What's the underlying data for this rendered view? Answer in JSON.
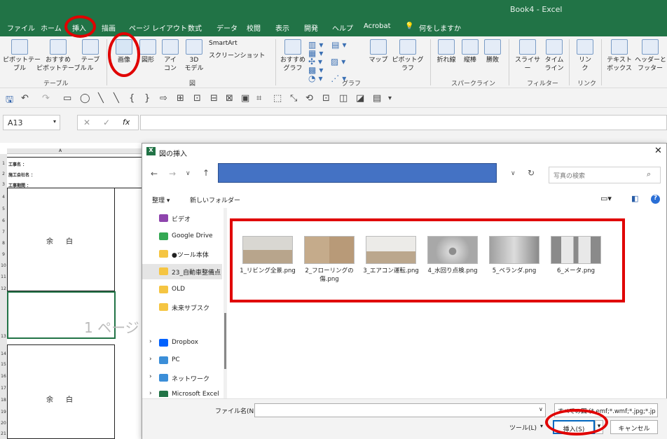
{
  "app": {
    "title": "Book4 - Excel"
  },
  "tabs": [
    "ファイル",
    "ホーム",
    "挿入",
    "描画",
    "ページ レイアウト",
    "数式",
    "データ",
    "校閲",
    "表示",
    "開発",
    "ヘルプ",
    "Acrobat",
    "何をしますか"
  ],
  "ribbon": {
    "pivot": "ピボットテー\nブル",
    "recommended_pivot": "おすすめ\nピボットテーブル",
    "table": "テーブル",
    "table_group": "テーブル",
    "image": "画像",
    "shape": "図形",
    "icon": "アイ\nコン",
    "model3d": "3D\nモデル",
    "smartart": "SmartArt",
    "screenshot": "スクリーンショット",
    "fig_group": "図",
    "rec_chart": "おすすめ\nグラフ",
    "map": "マップ",
    "pivot_chart": "ピボットグラフ",
    "chart_group": "グラフ",
    "line": "折れ線",
    "column": "縦棒",
    "winloss": "勝敗",
    "spark_group": "スパークライン",
    "slicer": "スライサー",
    "timeline": "タイム\nライン",
    "filter_group": "フィルター",
    "link": "リン\nク",
    "link_group": "リンク",
    "textbox": "テキスト\nボックス",
    "header": "ヘッダーと\nフッター"
  },
  "namebox": "A13",
  "fx": "fx",
  "sheet": {
    "col_a": "A",
    "row_labels": [
      "1",
      "2",
      "3",
      "4",
      "5",
      "6",
      "7",
      "8",
      "9",
      "10",
      "11",
      "12",
      "13",
      "14",
      "15",
      "16",
      "17",
      "18",
      "19",
      "20",
      "21",
      "22"
    ],
    "h1": "工事名 ：",
    "h2": "施工会社名 ：",
    "h3": "工事期間 ：",
    "margin1": "余白",
    "page_watermark": "1 ページ",
    "margin2": "余白"
  },
  "dialog": {
    "title": "図の挿入",
    "search_placeholder": "写真の検索",
    "organize": "整理 ▾",
    "new_folder": "新しいフォルダー",
    "nav": [
      "ビデオ",
      "Google Drive",
      "●ツール本体",
      "23_自動車整備点",
      "OLD",
      "未来サブスク",
      "Dropbox",
      "PC",
      "ネットワーク",
      "Microsoft Excel"
    ],
    "files": [
      "1_リビング全景.png",
      "2_フローリングの傷.png",
      "3_エアコン運転.png",
      "4_水回り点検.png",
      "5_ベランダ.png",
      "6_メータ.png"
    ],
    "filename_label": "ファイル名(N):",
    "filename_value": "",
    "filetype": "すべての図 (*.emf;*.wmf;*.jpg;*.jp",
    "tools": "ツール(L)",
    "insert": "挿入(S)",
    "cancel": "キャンセル"
  },
  "colors": {
    "excel_green": "#217346",
    "highlight_red": "#e00000",
    "address_blue": "#4472c4"
  }
}
